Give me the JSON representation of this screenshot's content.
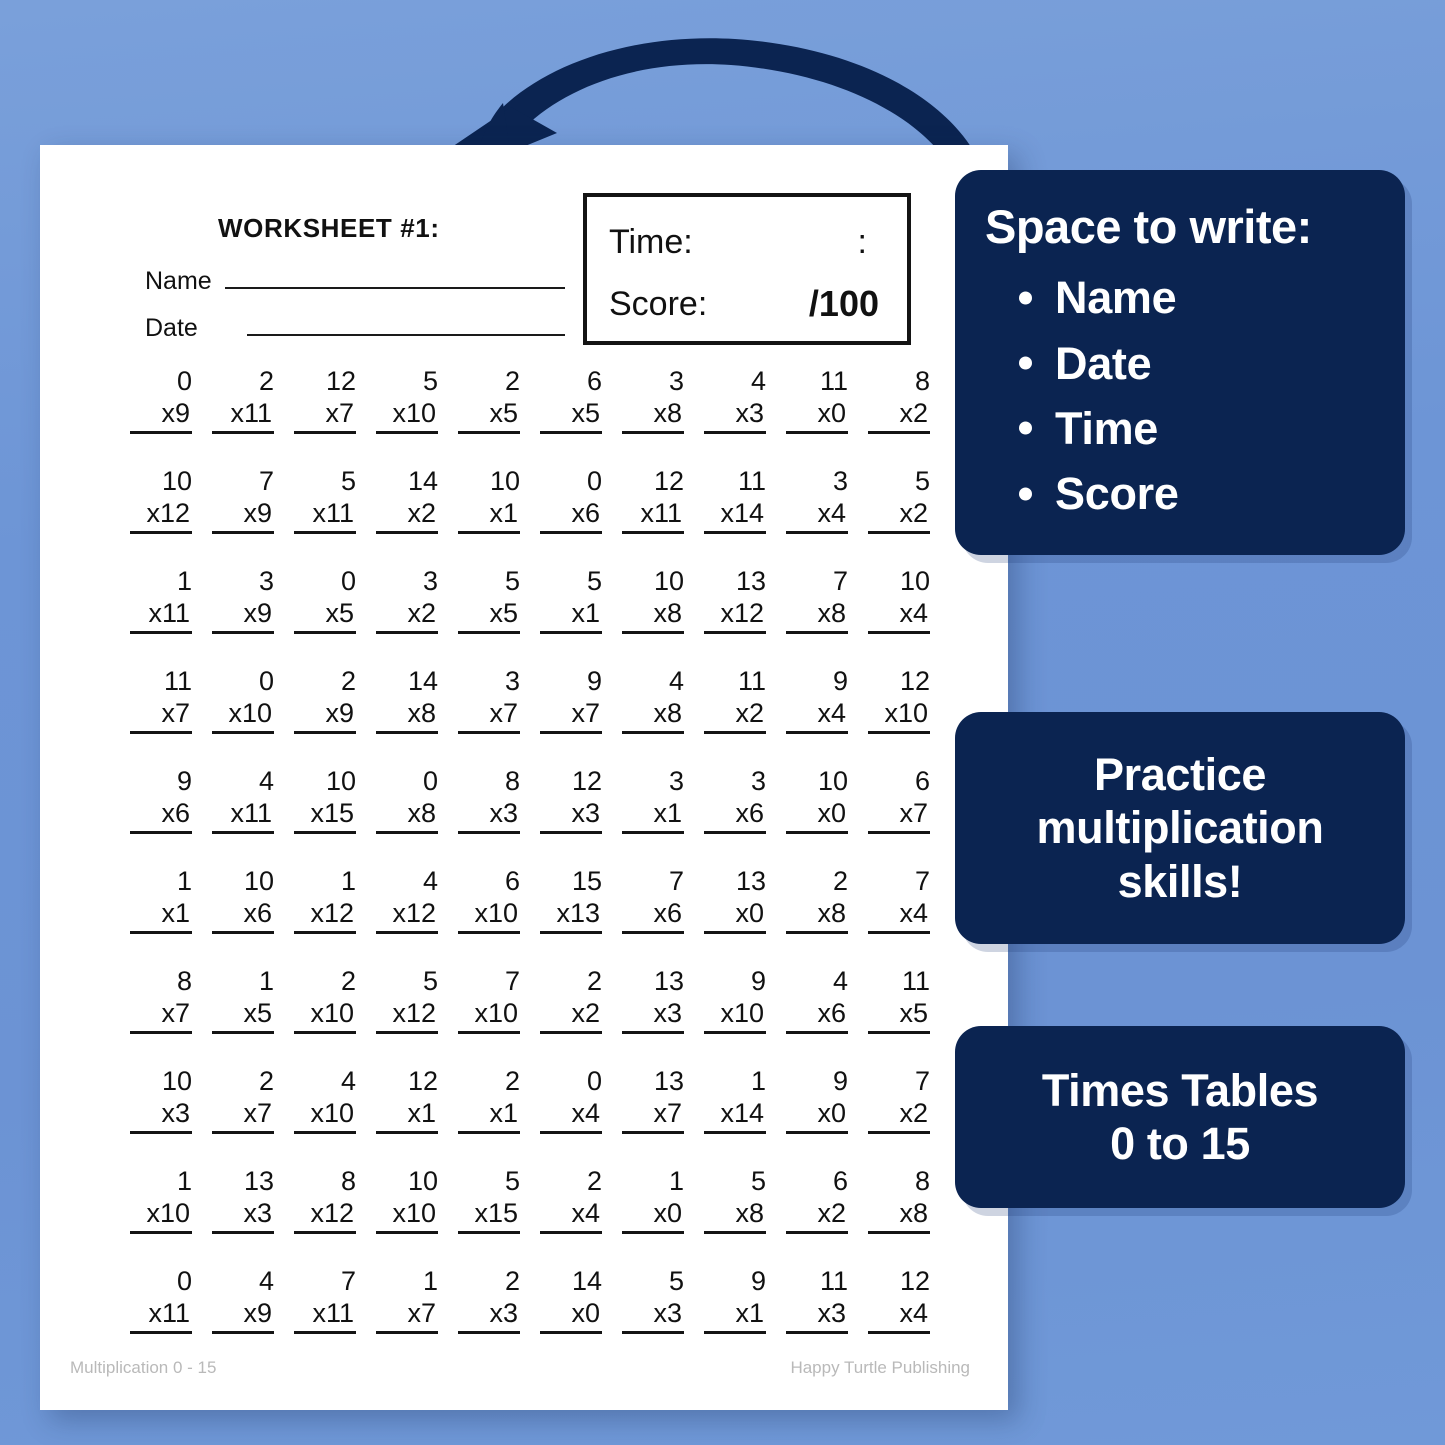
{
  "theme": {
    "background_blue": "#6d94d4",
    "card_navy": "#0b2451",
    "paper_white": "#ffffff",
    "ink_black": "#111111",
    "footer_grey": "#b9b9b9"
  },
  "worksheet": {
    "title": "WORKSHEET #1:",
    "name_label": "Name",
    "date_label": "Date",
    "time_label": "Time:",
    "time_value": ":",
    "score_label": "Score:",
    "score_value": "/100",
    "footer_left": "Multiplication 0 - 15",
    "footer_right": "Happy Turtle Publishing",
    "columns": 10,
    "rows": 10,
    "problems": [
      [
        {
          "a": "0",
          "b": "x9"
        },
        {
          "a": "2",
          "b": "x11"
        },
        {
          "a": "12",
          "b": "x7"
        },
        {
          "a": "5",
          "b": "x10"
        },
        {
          "a": "2",
          "b": "x5"
        },
        {
          "a": "6",
          "b": "x5"
        },
        {
          "a": "3",
          "b": "x8"
        },
        {
          "a": "4",
          "b": "x3"
        },
        {
          "a": "11",
          "b": "x0"
        },
        {
          "a": "8",
          "b": "x2"
        }
      ],
      [
        {
          "a": "10",
          "b": "x12"
        },
        {
          "a": "7",
          "b": "x9"
        },
        {
          "a": "5",
          "b": "x11"
        },
        {
          "a": "14",
          "b": "x2"
        },
        {
          "a": "10",
          "b": "x1"
        },
        {
          "a": "0",
          "b": "x6"
        },
        {
          "a": "12",
          "b": "x11"
        },
        {
          "a": "11",
          "b": "x14"
        },
        {
          "a": "3",
          "b": "x4"
        },
        {
          "a": "5",
          "b": "x2"
        }
      ],
      [
        {
          "a": "1",
          "b": "x11"
        },
        {
          "a": "3",
          "b": "x9"
        },
        {
          "a": "0",
          "b": "x5"
        },
        {
          "a": "3",
          "b": "x2"
        },
        {
          "a": "5",
          "b": "x5"
        },
        {
          "a": "5",
          "b": "x1"
        },
        {
          "a": "10",
          "b": "x8"
        },
        {
          "a": "13",
          "b": "x12"
        },
        {
          "a": "7",
          "b": "x8"
        },
        {
          "a": "10",
          "b": "x4"
        }
      ],
      [
        {
          "a": "11",
          "b": "x7"
        },
        {
          "a": "0",
          "b": "x10"
        },
        {
          "a": "2",
          "b": "x9"
        },
        {
          "a": "14",
          "b": "x8"
        },
        {
          "a": "3",
          "b": "x7"
        },
        {
          "a": "9",
          "b": "x7"
        },
        {
          "a": "4",
          "b": "x8"
        },
        {
          "a": "11",
          "b": "x2"
        },
        {
          "a": "9",
          "b": "x4"
        },
        {
          "a": "12",
          "b": "x10"
        }
      ],
      [
        {
          "a": "9",
          "b": "x6"
        },
        {
          "a": "4",
          "b": "x11"
        },
        {
          "a": "10",
          "b": "x15"
        },
        {
          "a": "0",
          "b": "x8"
        },
        {
          "a": "8",
          "b": "x3"
        },
        {
          "a": "12",
          "b": "x3"
        },
        {
          "a": "3",
          "b": "x1"
        },
        {
          "a": "3",
          "b": "x6"
        },
        {
          "a": "10",
          "b": "x0"
        },
        {
          "a": "6",
          "b": "x7"
        }
      ],
      [
        {
          "a": "1",
          "b": "x1"
        },
        {
          "a": "10",
          "b": "x6"
        },
        {
          "a": "1",
          "b": "x12"
        },
        {
          "a": "4",
          "b": "x12"
        },
        {
          "a": "6",
          "b": "x10"
        },
        {
          "a": "15",
          "b": "x13"
        },
        {
          "a": "7",
          "b": "x6"
        },
        {
          "a": "13",
          "b": "x0"
        },
        {
          "a": "2",
          "b": "x8"
        },
        {
          "a": "7",
          "b": "x4"
        }
      ],
      [
        {
          "a": "8",
          "b": "x7"
        },
        {
          "a": "1",
          "b": "x5"
        },
        {
          "a": "2",
          "b": "x10"
        },
        {
          "a": "5",
          "b": "x12"
        },
        {
          "a": "7",
          "b": "x10"
        },
        {
          "a": "2",
          "b": "x2"
        },
        {
          "a": "13",
          "b": "x3"
        },
        {
          "a": "9",
          "b": "x10"
        },
        {
          "a": "4",
          "b": "x6"
        },
        {
          "a": "11",
          "b": "x5"
        }
      ],
      [
        {
          "a": "10",
          "b": "x3"
        },
        {
          "a": "2",
          "b": "x7"
        },
        {
          "a": "4",
          "b": "x10"
        },
        {
          "a": "12",
          "b": "x1"
        },
        {
          "a": "2",
          "b": "x1"
        },
        {
          "a": "0",
          "b": "x4"
        },
        {
          "a": "13",
          "b": "x7"
        },
        {
          "a": "1",
          "b": "x14"
        },
        {
          "a": "9",
          "b": "x0"
        },
        {
          "a": "7",
          "b": "x2"
        }
      ],
      [
        {
          "a": "1",
          "b": "x10"
        },
        {
          "a": "13",
          "b": "x3"
        },
        {
          "a": "8",
          "b": "x12"
        },
        {
          "a": "10",
          "b": "x10"
        },
        {
          "a": "5",
          "b": "x15"
        },
        {
          "a": "2",
          "b": "x4"
        },
        {
          "a": "1",
          "b": "x0"
        },
        {
          "a": "5",
          "b": "x8"
        },
        {
          "a": "6",
          "b": "x2"
        },
        {
          "a": "8",
          "b": "x8"
        }
      ],
      [
        {
          "a": "0",
          "b": "x11"
        },
        {
          "a": "4",
          "b": "x9"
        },
        {
          "a": "7",
          "b": "x11"
        },
        {
          "a": "1",
          "b": "x7"
        },
        {
          "a": "2",
          "b": "x3"
        },
        {
          "a": "14",
          "b": "x0"
        },
        {
          "a": "5",
          "b": "x3"
        },
        {
          "a": "9",
          "b": "x1"
        },
        {
          "a": "11",
          "b": "x3"
        },
        {
          "a": "12",
          "b": "x4"
        }
      ]
    ]
  },
  "cards": {
    "space_to_write": {
      "heading": "Space to write:",
      "items": [
        "Name",
        "Date",
        "Time",
        "Score"
      ]
    },
    "practice": {
      "text": "Practice multiplication skills!"
    },
    "times_tables": {
      "line1": "Times Tables",
      "line2": "0 to 15"
    }
  }
}
